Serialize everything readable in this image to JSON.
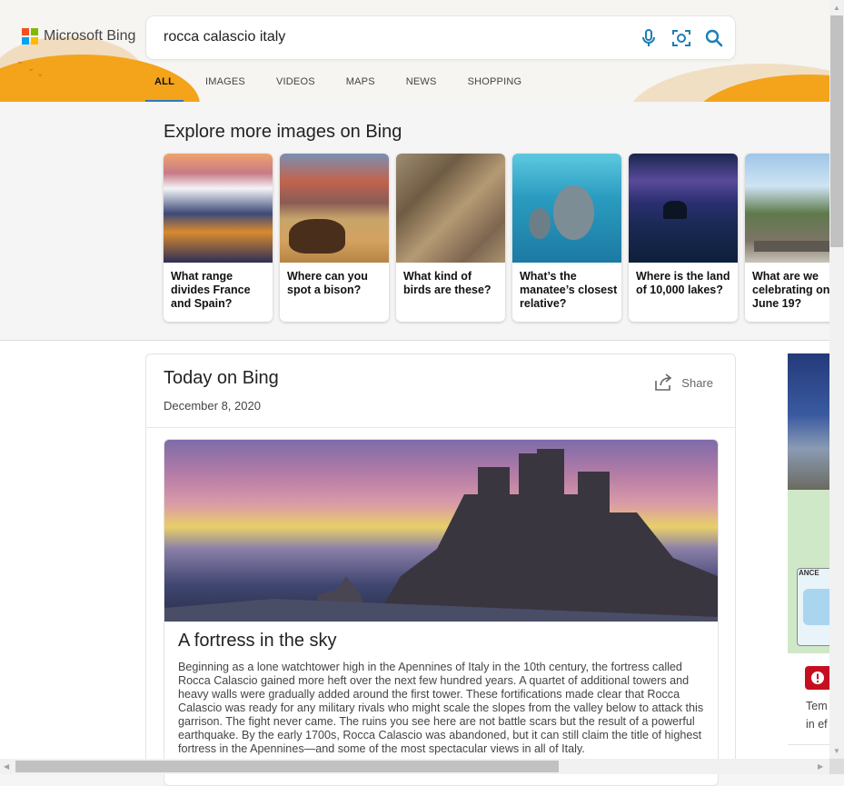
{
  "brand": {
    "name": "Microsoft Bing",
    "colors": [
      "#f25022",
      "#7fba00",
      "#00a4ef",
      "#ffb900"
    ],
    "accent": "#2b7bbd"
  },
  "search": {
    "query": "rocca calascio italy",
    "icons": [
      "microphone-icon",
      "visual-search-icon",
      "search-icon"
    ]
  },
  "tabs": [
    {
      "label": "ALL",
      "active": true
    },
    {
      "label": "IMAGES",
      "active": false
    },
    {
      "label": "VIDEOS",
      "active": false
    },
    {
      "label": "MAPS",
      "active": false
    },
    {
      "label": "NEWS",
      "active": false
    },
    {
      "label": "SHOPPING",
      "active": false
    }
  ],
  "explore": {
    "title": "Explore more images on Bing",
    "cards": [
      {
        "caption": "What range divides France and Spain?"
      },
      {
        "caption": "Where can you spot a bison?"
      },
      {
        "caption": "What kind of birds are these?"
      },
      {
        "caption": "What’s the manatee’s closest relative?"
      },
      {
        "caption": "Where is the land of 10,000 lakes?"
      },
      {
        "caption": "What are we celebrating on June 19?"
      }
    ]
  },
  "today": {
    "title": "Today on Bing",
    "date": "December 8, 2020",
    "share_label": "Share",
    "article_title": "A fortress in the sky",
    "article_body": "Beginning as a lone watchtower high in the Apennines of Italy in the 10th century, the fortress called Rocca Calascio gained more heft over the next few hundred years. A quartet of additional towers and heavy walls were gradually added around the first tower. These fortifications made clear that Rocca Calascio was ready for any military rivals who might scale the slopes from the valley below to attack this garrison. The fight never came. The ruins you see here are not battle scars but the result of a powerful earthquake. By the early 1700s, Rocca Calascio was abandoned, but it can still claim the title of highest fortress in the Apennines—and some of the most spectacular views in all of Italy."
  },
  "side_panel": {
    "map_label": "ANCE",
    "text_line1": "Tem",
    "text_line2": "in ef"
  }
}
